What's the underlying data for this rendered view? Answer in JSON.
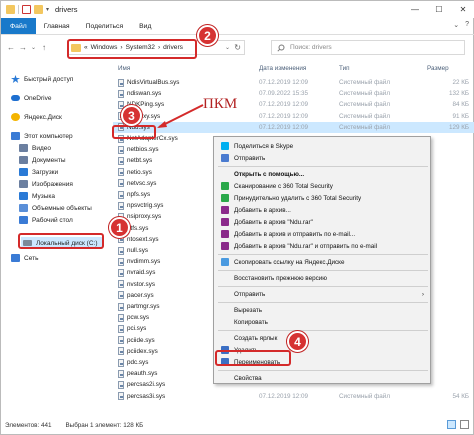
{
  "window": {
    "title": "drivers",
    "controls": [
      "—",
      "☐",
      "✕"
    ]
  },
  "ribbon": {
    "tabs": [
      "Файл",
      "Главная",
      "Поделиться",
      "Вид"
    ],
    "right": [
      "⌄",
      "?"
    ]
  },
  "address": {
    "back": "←",
    "forward": "→",
    "dropdown": "⌄",
    "up": "↑",
    "path": [
      "«",
      "Windows",
      "›",
      "System32",
      "›",
      "drivers"
    ],
    "path_dropdown": "⌄",
    "refresh": "↻",
    "search_placeholder": "Поиск: drivers",
    "search_icon": "search-icon"
  },
  "nav": {
    "items": [
      {
        "label": "Быстрый доступ",
        "icon": "star-icon",
        "color": "#2a7ad6"
      },
      {
        "label": "OneDrive",
        "icon": "cloud-icon",
        "color": "#1e6fd0"
      },
      {
        "label": "Яндекс.Диск",
        "icon": "yandex-disk-icon",
        "color": "#f4b400"
      },
      {
        "label": "Этот компьютер",
        "icon": "computer-icon",
        "color": "#3a7bd5"
      },
      {
        "label": "Видео",
        "icon": "video-icon",
        "color": "#6b7fa0"
      },
      {
        "label": "Документы",
        "icon": "documents-icon",
        "color": "#6b7fa0"
      },
      {
        "label": "Загрузки",
        "icon": "downloads-icon",
        "color": "#2a7ad6"
      },
      {
        "label": "Изображения",
        "icon": "pictures-icon",
        "color": "#6b7fa0"
      },
      {
        "label": "Музыка",
        "icon": "music-icon",
        "color": "#2a7ad6"
      },
      {
        "label": "Объемные объекты",
        "icon": "3d-objects-icon",
        "color": "#5a8fd8"
      },
      {
        "label": "Рабочий стол",
        "icon": "desktop-icon",
        "color": "#3a7bd5"
      },
      {
        "label": "Локальный диск (C:)",
        "icon": "drive-icon",
        "color": "#7a8a9a"
      },
      {
        "label": "Сеть",
        "icon": "network-icon",
        "color": "#3a7bd5"
      }
    ]
  },
  "list": {
    "headers": {
      "name": "Имя",
      "date": "Дата изменения",
      "type": "Тип",
      "size": "Размер"
    },
    "rows": [
      {
        "name": "NdisVirtualBus.sys",
        "date": "07.12.2019 12:09",
        "type": "Системный файл",
        "size": "22 КБ"
      },
      {
        "name": "ndiswan.sys",
        "date": "07.09.2022 15:35",
        "type": "Системный файл",
        "size": "132 КБ"
      },
      {
        "name": "NDKPing.sys",
        "date": "07.12.2019 12:09",
        "type": "Системный файл",
        "size": "84 КБ"
      },
      {
        "name": "ndproxy.sys",
        "date": "07.12.2019 12:09",
        "type": "Системный файл",
        "size": "91 КБ"
      },
      {
        "name": "Ndu.sys",
        "date": "07.12.2019 12:09",
        "type": "Системный файл",
        "size": "129 КБ"
      },
      {
        "name": "NetAdapterCx.sys",
        "date": "",
        "type": "",
        "size": ""
      },
      {
        "name": "netbios.sys",
        "date": "",
        "type": "",
        "size": ""
      },
      {
        "name": "netbt.sys",
        "date": "",
        "type": "",
        "size": ""
      },
      {
        "name": "netio.sys",
        "date": "",
        "type": "",
        "size": ""
      },
      {
        "name": "netvsc.sys",
        "date": "",
        "type": "",
        "size": ""
      },
      {
        "name": "npfs.sys",
        "date": "",
        "type": "",
        "size": ""
      },
      {
        "name": "npsvctrig.sys",
        "date": "",
        "type": "",
        "size": ""
      },
      {
        "name": "nsiproxy.sys",
        "date": "",
        "type": "",
        "size": ""
      },
      {
        "name": "ntfs.sys",
        "date": "",
        "type": "",
        "size": ""
      },
      {
        "name": "ntosext.sys",
        "date": "",
        "type": "",
        "size": ""
      },
      {
        "name": "null.sys",
        "date": "",
        "type": "",
        "size": ""
      },
      {
        "name": "nvdimm.sys",
        "date": "",
        "type": "",
        "size": ""
      },
      {
        "name": "nvraid.sys",
        "date": "",
        "type": "",
        "size": ""
      },
      {
        "name": "nvstor.sys",
        "date": "",
        "type": "",
        "size": ""
      },
      {
        "name": "pacer.sys",
        "date": "",
        "type": "",
        "size": ""
      },
      {
        "name": "partmgr.sys",
        "date": "",
        "type": "",
        "size": ""
      },
      {
        "name": "pcw.sys",
        "date": "",
        "type": "",
        "size": ""
      },
      {
        "name": "pci.sys",
        "date": "",
        "type": "",
        "size": ""
      },
      {
        "name": "pciide.sys",
        "date": "",
        "type": "",
        "size": ""
      },
      {
        "name": "pciidex.sys",
        "date": "",
        "type": "",
        "size": ""
      },
      {
        "name": "pdc.sys",
        "date": "",
        "type": "",
        "size": ""
      },
      {
        "name": "peauth.sys",
        "date": "",
        "type": "",
        "size": ""
      },
      {
        "name": "percsas2i.sys",
        "date": "",
        "type": "",
        "size": ""
      },
      {
        "name": "percsas3i.sys",
        "date": "07.12.2019 12:09",
        "type": "Системный файл",
        "size": "54 КБ"
      }
    ]
  },
  "context_menu": {
    "items": [
      {
        "label": "Поделиться в Skype",
        "icon": "skype-icon",
        "color": "#00aff0"
      },
      {
        "label": "Отправить",
        "icon": "send-icon",
        "color": "#4a7bd0"
      },
      {
        "sep": true
      },
      {
        "label": "Открыть с помощью...",
        "bold": true
      },
      {
        "label": "Сканирование с 360 Total Security",
        "icon": "360-scan-icon",
        "color": "#2aa84a"
      },
      {
        "label": "Принудительно удалить с 360 Total Security",
        "icon": "360-delete-icon",
        "color": "#2aa84a"
      },
      {
        "label": "Добавить в архив...",
        "icon": "winrar-icon",
        "color": "#8b2a8b"
      },
      {
        "label": "Добавить в архив \"Ndu.rar\"",
        "icon": "winrar-icon",
        "color": "#8b2a8b"
      },
      {
        "label": "Добавить в архив и отправить по e-mail...",
        "icon": "winrar-icon",
        "color": "#8b2a8b"
      },
      {
        "label": "Добавить в архив \"Ndu.rar\" и отправить по e-mail",
        "icon": "winrar-icon",
        "color": "#8b2a8b"
      },
      {
        "sep": true
      },
      {
        "label": "Скопировать ссылку на Яндекс.Диске",
        "icon": "yandex-disk-icon",
        "color": "#4a9ae0"
      },
      {
        "sep": true
      },
      {
        "label": "Восстановить прежнюю версию"
      },
      {
        "sep": true
      },
      {
        "label": "Отправить",
        "submenu": "›"
      },
      {
        "sep": true
      },
      {
        "label": "Вырезать"
      },
      {
        "label": "Копировать"
      },
      {
        "sep": true
      },
      {
        "label": "Создать ярлык"
      },
      {
        "label": "Удалить",
        "icon": "shield-icon",
        "color": "#3b6fc4"
      },
      {
        "label": "Переименовать",
        "icon": "shield-icon",
        "color": "#3b6fc4"
      },
      {
        "sep": true
      },
      {
        "label": "Свойства"
      }
    ]
  },
  "status": {
    "count": "Элементов: 441",
    "selected": "Выбран 1 элемент: 128 КБ"
  },
  "annotations": {
    "pkm_label": "ПКМ",
    "badges": [
      "1",
      "2",
      "3",
      "4"
    ],
    "color": "#d42a2a"
  }
}
